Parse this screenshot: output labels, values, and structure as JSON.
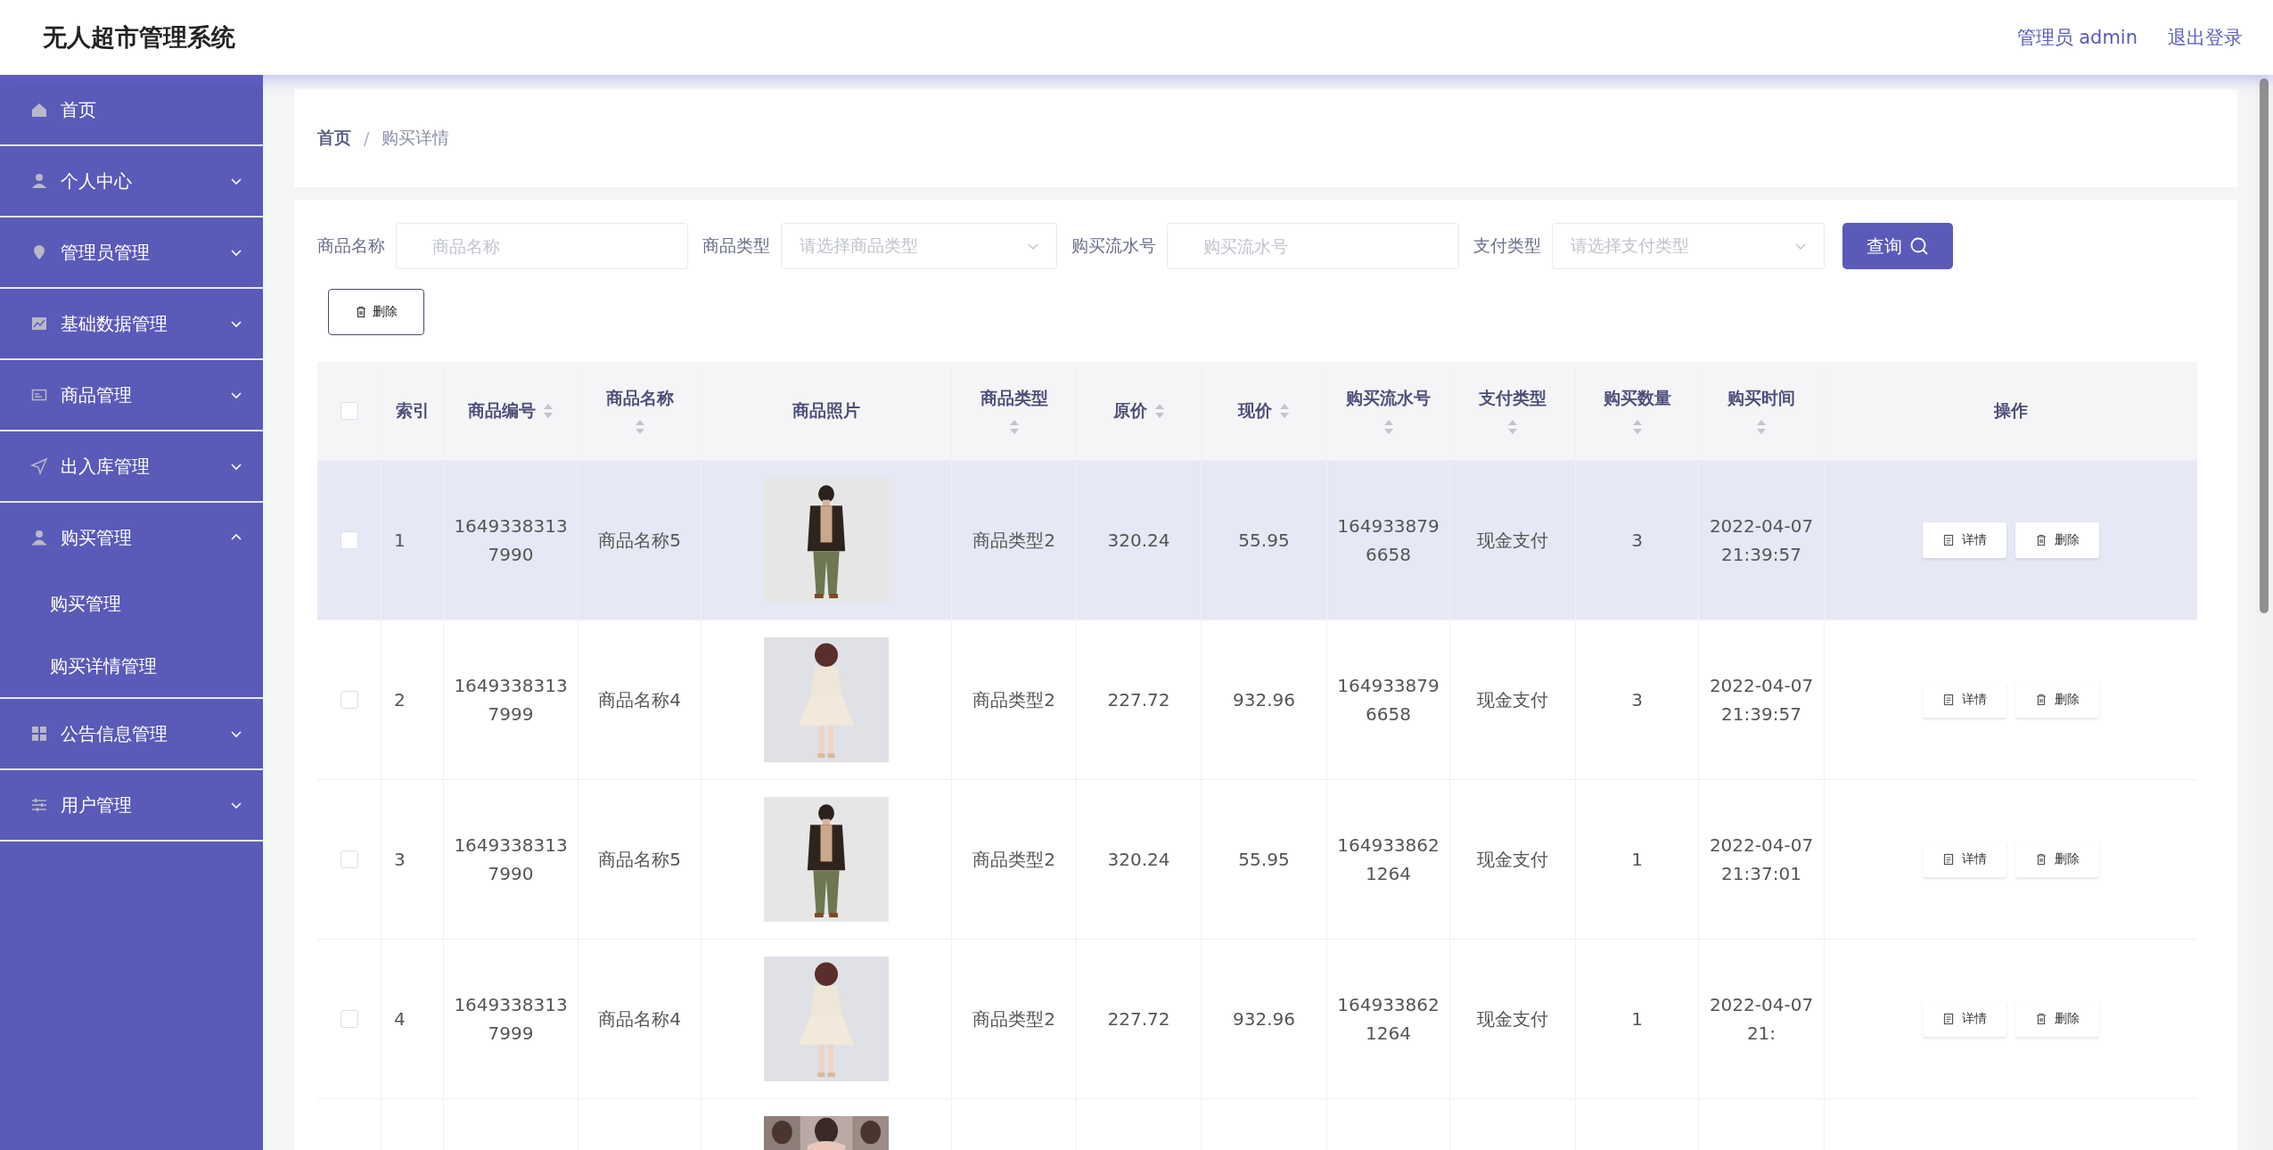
{
  "header": {
    "title": "无人超市管理系统",
    "user": "管理员 admin",
    "logout": "退出登录"
  },
  "sidebar": {
    "items": [
      {
        "label": "首页",
        "has_arrow": false
      },
      {
        "label": "个人中心",
        "expanded": false,
        "has_arrow": true
      },
      {
        "label": "管理员管理",
        "expanded": false,
        "has_arrow": true
      },
      {
        "label": "基础数据管理",
        "expanded": false,
        "has_arrow": true
      },
      {
        "label": "商品管理",
        "expanded": false,
        "has_arrow": true
      },
      {
        "label": "出入库管理",
        "expanded": false,
        "has_arrow": true
      },
      {
        "label": "购买管理",
        "expanded": true,
        "has_arrow": true,
        "children": [
          {
            "label": "购买管理"
          },
          {
            "label": "购买详情管理"
          }
        ]
      },
      {
        "label": "公告信息管理",
        "expanded": false,
        "has_arrow": true
      },
      {
        "label": "用户管理",
        "expanded": false,
        "has_arrow": true
      }
    ]
  },
  "breadcrumb": {
    "separator": "/",
    "items": [
      {
        "label": "首页",
        "current": false
      },
      {
        "label": "购买详情",
        "current": true
      }
    ]
  },
  "filters": [
    {
      "label": "商品名称",
      "kind": "input",
      "placeholder": "商品名称"
    },
    {
      "label": "商品类型",
      "kind": "select",
      "placeholder": "请选择商品类型"
    },
    {
      "label": "购买流水号",
      "kind": "input",
      "placeholder": "购买流水号"
    },
    {
      "label": "支付类型",
      "kind": "select",
      "placeholder": "请选择支付类型"
    }
  ],
  "search_button": "查询",
  "delete_button": "删除",
  "table": {
    "header_checked": false,
    "columns": [
      {
        "label": "索引",
        "sortable": false
      },
      {
        "label": "商品编号",
        "sortable": true
      },
      {
        "label": "商品名称",
        "sortable": true
      },
      {
        "label": "商品照片",
        "sortable": false
      },
      {
        "label": "商品类型",
        "sortable": true
      },
      {
        "label": "原价",
        "sortable": true
      },
      {
        "label": "现价",
        "sortable": true
      },
      {
        "label": "购买流水号",
        "sortable": true
      },
      {
        "label": "支付类型",
        "sortable": true
      },
      {
        "label": "购买数量",
        "sortable": true
      },
      {
        "label": "购买时间",
        "sortable": true
      },
      {
        "label": "操作",
        "sortable": false
      }
    ],
    "rows": [
      {
        "checked": false,
        "highlighted": true,
        "cells": [
          "1",
          "1649338313\n7990",
          "商品名称5",
          {
            "kind": "picture"
          },
          "商品类型2",
          "320.24",
          "55.95",
          "164933879\n6658",
          "现金支付",
          "3",
          "2022-04-07\n21:39:57"
        ],
        "actions": [
          "详情",
          "删除"
        ]
      },
      {
        "checked": false,
        "highlighted": false,
        "cells": [
          "2",
          "1649338313\n7999",
          "商品名称4",
          {
            "kind": "picture"
          },
          "商品类型2",
          "227.72",
          "932.96",
          "164933879\n6658",
          "现金支付",
          "3",
          "2022-04-07\n21:39:57"
        ],
        "actions": [
          "详情",
          "删除"
        ]
      },
      {
        "checked": false,
        "highlighted": false,
        "cells": [
          "3",
          "1649338313\n7990",
          "商品名称5",
          {
            "kind": "picture"
          },
          "商品类型2",
          "320.24",
          "55.95",
          "164933862\n1264",
          "现金支付",
          "1",
          "2022-04-07\n21:37:01"
        ],
        "actions": [
          "详情",
          "删除"
        ]
      },
      {
        "checked": false,
        "highlighted": false,
        "cells": [
          "4",
          "1649338313\n7999",
          "商品名称4",
          {
            "kind": "picture"
          },
          "商品类型2",
          "227.72",
          "932.96",
          "164933862\n1264",
          "现金支付",
          "1",
          "2022-04-07\n21:"
        ],
        "actions": [
          "详情",
          "删除"
        ]
      },
      {
        "highlighted": false,
        "cells": [
          "",
          "",
          "",
          {
            "kind": "picture"
          },
          "",
          "",
          "",
          "",
          "",
          "",
          ""
        ],
        "actions": []
      }
    ]
  }
}
